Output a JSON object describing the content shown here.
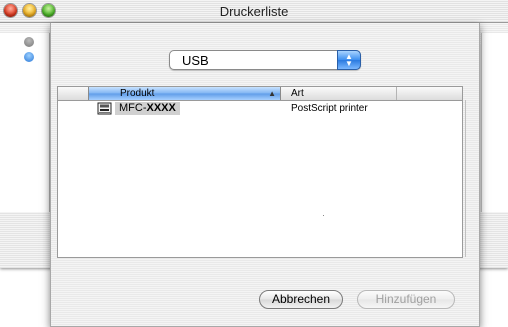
{
  "window": {
    "title": "Druckerliste"
  },
  "sheet": {
    "connection_popup": {
      "selected": "USB",
      "arrow_icon": "up-down-arrows-icon"
    },
    "table": {
      "columns": [
        "Produkt",
        "Art"
      ],
      "sort_column": "Produkt",
      "sort_icon": "sort-ascending-icon",
      "rows": [
        {
          "icon": "printer-icon",
          "product_prefix": "MFC-",
          "product_model": "XXXX",
          "type": "PostScript printer"
        }
      ]
    },
    "buttons": {
      "cancel": "Abbrechen",
      "add": "Hinzufügen"
    }
  },
  "colors": {
    "accent": "#3c8ef0",
    "selection": "#d0d0d0",
    "disabled_text": "#a0a0a0"
  }
}
